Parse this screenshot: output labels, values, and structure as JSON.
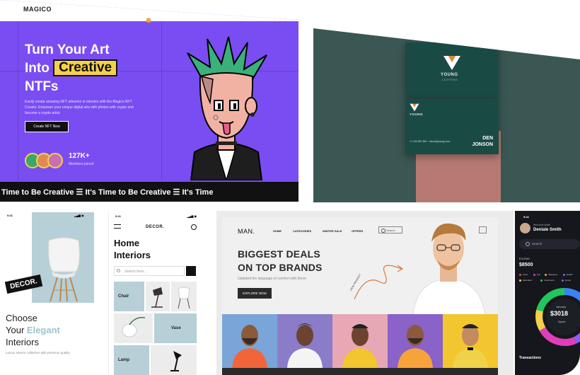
{
  "nft_panel": {
    "logo": "MAGICO",
    "headline_line1": "Turn Your Art",
    "headline_into": "Into",
    "headline_highlight": "Creative",
    "headline_line3": "NTFs",
    "subtext": "Easily create amazing NFT artworks in minutes with the Magico NFT Creator. Empower your unique digital arts with photos with crypto and become a crypto artist.",
    "cta_label": "Create NFT Now",
    "members_count": "127K+",
    "members_label": "Members joined",
    "ticker": "Time to Be Creative ☰ It's Time to Be Creative ☰ It's Time",
    "colors": {
      "background": "#7a4df2",
      "highlight": "#f5d04a",
      "accent": "#2fb47a"
    }
  },
  "card_panel": {
    "brand_name": "YOUNG",
    "brand_sub": "CLOTHING",
    "person_first": "DEN",
    "person_last": "JONSON",
    "contact": "+1 234 567 890 · name@young.com",
    "colors": {
      "background": "#3b5753",
      "card": "#1a4a44",
      "stand": "#b67a73"
    }
  },
  "decor_panel": {
    "status_time": "9:41",
    "badge": "DECOR.",
    "title_line1": "Choose",
    "title_your": "Your",
    "title_accent": "Elegant",
    "title_line3": "Interiors",
    "description": "Luxury interior collection with premium quality",
    "colors": {
      "photo": "#b7cfd6",
      "accent": "#9cc4cf"
    }
  },
  "home_panel": {
    "status_time": "9:41",
    "brand": "DECOR.",
    "title_line1": "Home",
    "title_line2": "Interiors",
    "search_placeholder": "Search here...",
    "tiles": [
      "Chair",
      "Vase",
      "Lamp"
    ]
  },
  "man_panel": {
    "logo": "MAN.",
    "nav": [
      "HOME",
      "CATEGORIES",
      "WINTER SALE",
      "OFFERS"
    ],
    "search_label": "Search",
    "headline_line1": "BIGGEST DEALS",
    "headline_line2": "ON TOP BRANDS",
    "tagline": "Updated the language of comfort with these",
    "button_label": "EXPLORE NOW",
    "scribble_label": "VIEW PRODUCT",
    "tile_colors": [
      "#7aa5d8",
      "#8a7cc9",
      "#e7a7b4",
      "#f7a33b",
      "#f2c62e"
    ]
  },
  "finance_panel": {
    "status_time": "9:41",
    "welcome": "Welcome Back!",
    "user_name": "Deniale Smith",
    "search_placeholder": "Search",
    "income_label": "Income",
    "income_value": "$8500",
    "legend": [
      {
        "label": "Food",
        "color": "#e5484d"
      },
      {
        "label": "Fun",
        "color": "#e03eb8"
      },
      {
        "label": "Shopping",
        "color": "#f5a524"
      },
      {
        "label": "Health",
        "color": "#3b82f6"
      },
      {
        "label": "Education",
        "color": "#f5d04a"
      },
      {
        "label": "Investment",
        "color": "#22c55e"
      },
      {
        "label": "Home",
        "color": "#8b5cf6"
      }
    ],
    "month": "January",
    "spent_value": "$3018",
    "spent_label": "Spent",
    "transactions_label": "Transactions"
  }
}
